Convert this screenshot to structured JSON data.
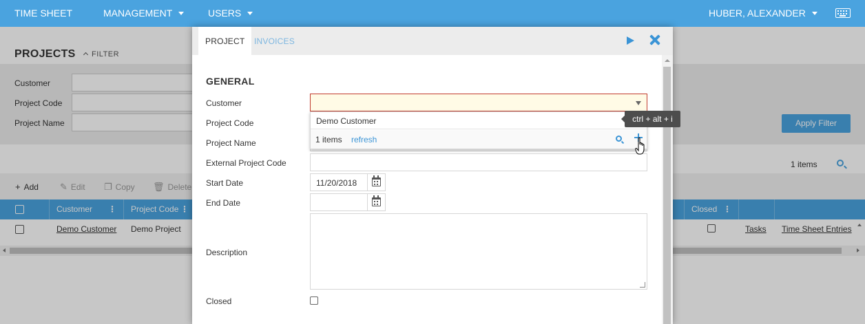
{
  "nav": {
    "timesheet": "TIME SHEET",
    "management": "MANAGEMENT",
    "users": "USERS",
    "user_name": "HUBER, ALEXANDER",
    "keyboard_icon": "keyboard-icon"
  },
  "projects_page": {
    "title": "PROJECTS",
    "filter_toggle": "FILTER",
    "filters": [
      {
        "label": "Customer",
        "value": ""
      },
      {
        "label": "Project Code",
        "value": ""
      },
      {
        "label": "Project Name",
        "value": ""
      }
    ],
    "apply_filter": "Apply Filter",
    "item_count": "1 items",
    "toolbar": {
      "add": "Add",
      "edit": "Edit",
      "copy": "Copy",
      "delete": "Delete"
    },
    "grid": {
      "columns": {
        "customer": "Customer",
        "project_code": "Project Code",
        "closed": "Closed"
      },
      "rows": [
        {
          "customer": "Demo Customer",
          "project_code": "Demo Project",
          "closed": false,
          "tasks": "Tasks",
          "time_sheet_entries": "Time Sheet Entries"
        }
      ]
    }
  },
  "modal": {
    "tabs": [
      "PROJECT",
      "INVOICES"
    ],
    "active_tab": "PROJECT",
    "section_title": "GENERAL",
    "fields": {
      "customer": {
        "label": "Customer",
        "value": ""
      },
      "project_code": {
        "label": "Project Code",
        "value": ""
      },
      "project_name": {
        "label": "Project Name",
        "value": ""
      },
      "external_project_code": {
        "label": "External Project Code",
        "value": ""
      },
      "start_date": {
        "label": "Start Date",
        "value": "11/20/2018"
      },
      "end_date": {
        "label": "End Date",
        "value": ""
      },
      "description": {
        "label": "Description",
        "value": ""
      },
      "closed": {
        "label": "Closed",
        "checked": false
      }
    }
  },
  "customer_dropdown": {
    "options": [
      "Demo Customer"
    ],
    "count": "1 items",
    "refresh": "refresh",
    "add_tooltip": "ctrl + alt + i"
  },
  "colors": {
    "accent": "#4aa3df",
    "link": "#3a94d6",
    "invalid_border": "#c0392b",
    "invalid_bg": "#fffbe6",
    "tooltip_bg": "#4d4d4d"
  }
}
